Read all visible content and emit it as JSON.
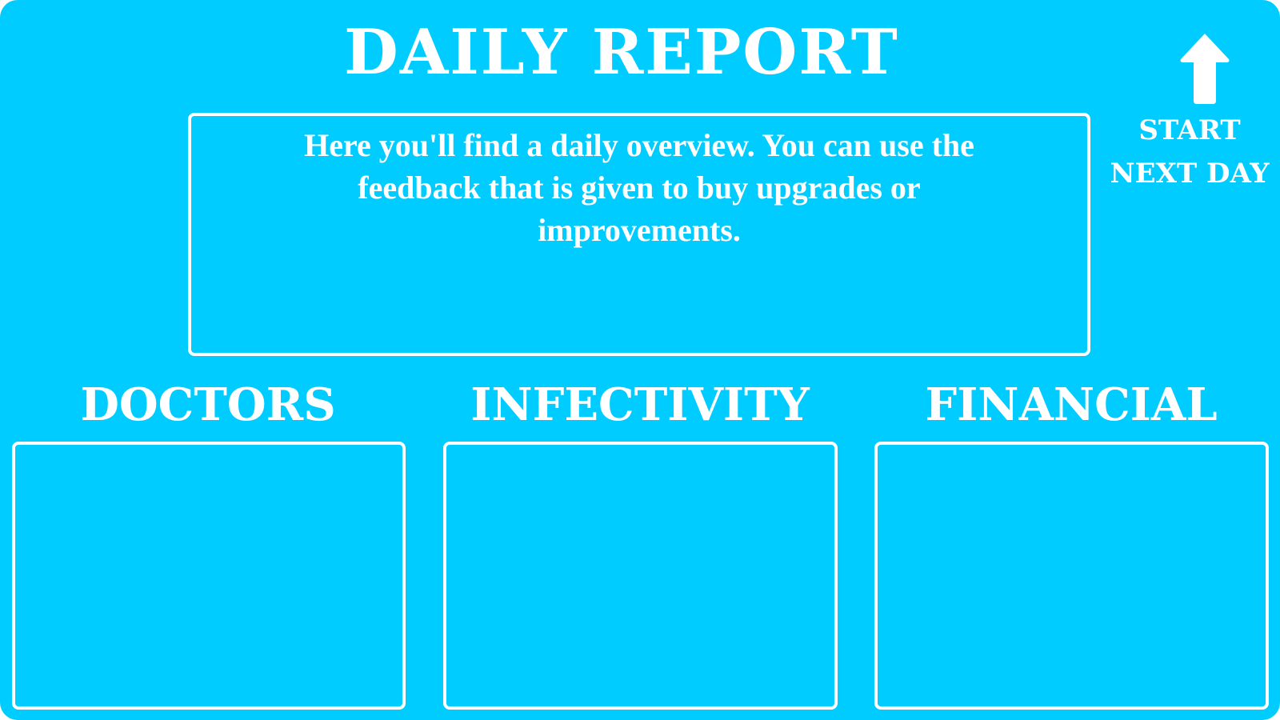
{
  "screen": {
    "title": "DAILY REPORT",
    "intro_text": "Here you'll find a daily overview. You can use the feedback that is given to buy upgrades or improvements.",
    "next_day_button": {
      "line1": "START",
      "line2": "NEXT DAY",
      "icon": "arrow-up-icon"
    },
    "sections": [
      {
        "heading": "DOCTORS"
      },
      {
        "heading": "INFECTIVITY"
      },
      {
        "heading": "FINANCIAL"
      }
    ]
  },
  "colors": {
    "background": "#00ccff",
    "foreground": "#ffffff"
  }
}
